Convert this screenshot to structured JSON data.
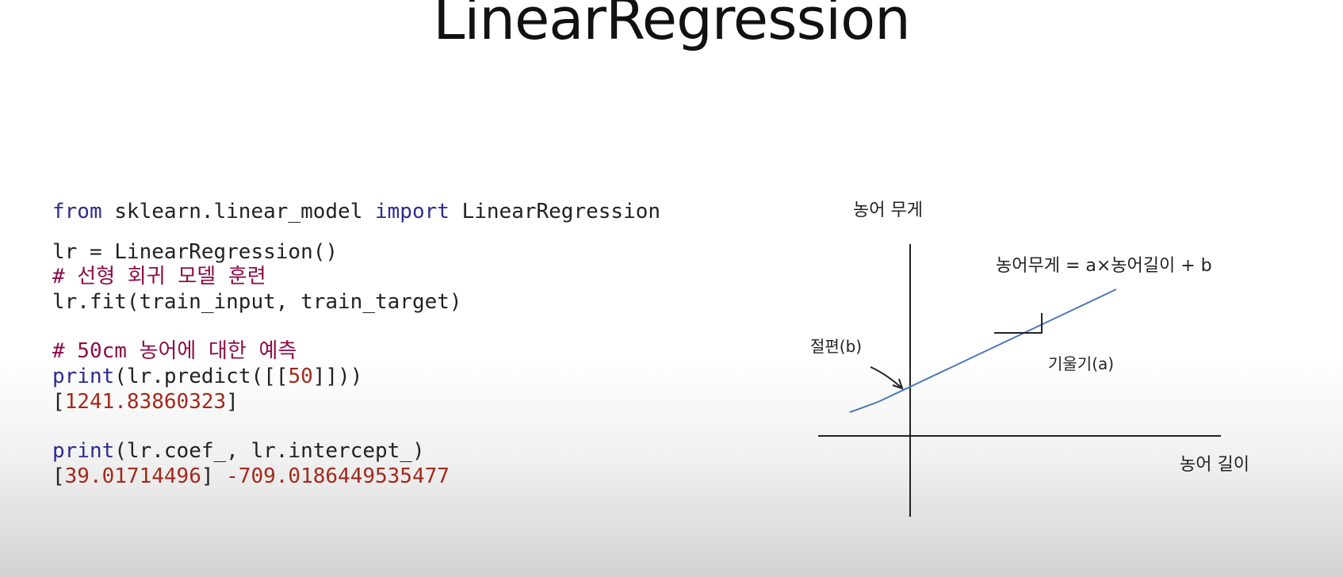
{
  "slide": {
    "title": "LinearRegression"
  },
  "code": {
    "line1": {
      "kw1": "from",
      "mid": " sklearn.linear_model ",
      "kw2": "import",
      "rest": " LinearRegression"
    },
    "line2": "lr = LinearRegression()",
    "line3": "# 선형 회귀 모델 훈련",
    "line4": "lr.fit(train_input, train_target)",
    "line5": "# 50cm 농어에 대한 예측",
    "line6": {
      "kw": "print",
      "pre": "(lr.predict([[",
      "num": "50",
      "post": "]]))"
    },
    "line7": {
      "open": "[",
      "num": "1241.83860323",
      "close": "]"
    },
    "line8": {
      "kw": "print",
      "rest": "(lr.coef_, lr.intercept_)"
    },
    "line9": {
      "open": "[",
      "num1": "39.01714496",
      "close": "] ",
      "num2": "-709.0186449535477"
    }
  },
  "diagram": {
    "y_axis_label": "농어 무게",
    "x_axis_label": "농어 길이",
    "equation": "농어무게 = a×농어길이 + b",
    "intercept_label": "절편(b)",
    "slope_label": "기울기(a)",
    "line_color": "#4a78b8",
    "ink_color": "#222222"
  }
}
